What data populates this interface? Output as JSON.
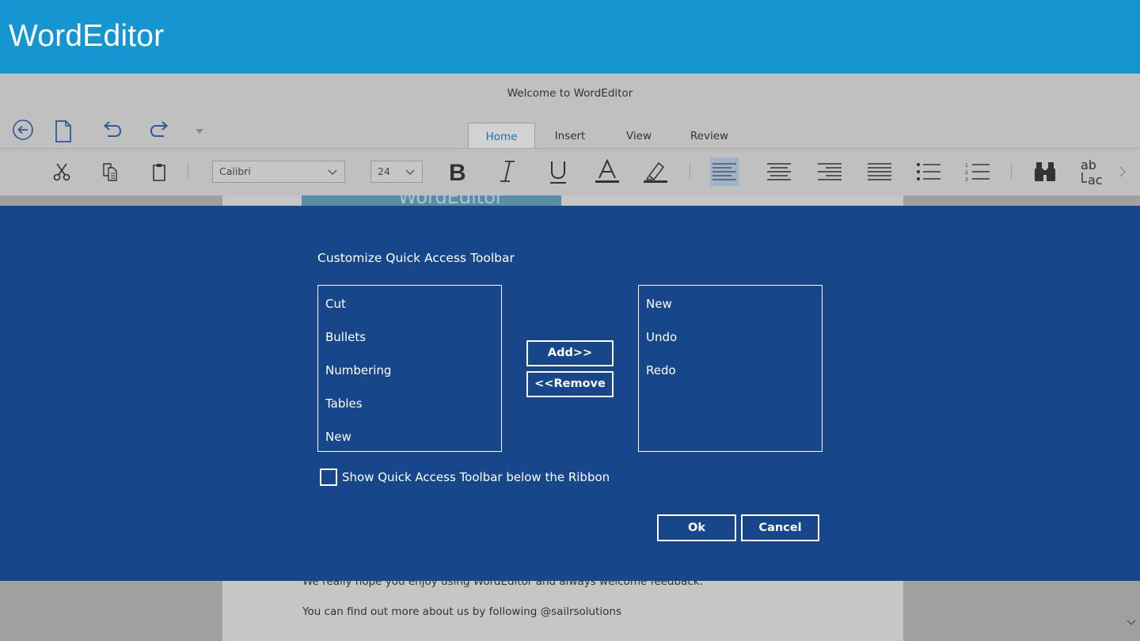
{
  "app": {
    "title": "WordEditor"
  },
  "document": {
    "title": "Welcome to WordEditor"
  },
  "quick_access": {
    "icons": [
      "back-arrow-icon",
      "new-document-icon",
      "undo-icon",
      "redo-icon",
      "dropdown-icon"
    ]
  },
  "tabs": [
    {
      "label": "Home",
      "active": true
    },
    {
      "label": "Insert",
      "active": false
    },
    {
      "label": "View",
      "active": false
    },
    {
      "label": "Review",
      "active": false
    }
  ],
  "toolbar": {
    "font_name": "Calibri",
    "font_size": "24",
    "find_replace_text": "ab\n↳ac"
  },
  "document_body": {
    "logo_text": "WordEditor",
    "line1": "We really hope you enjoy using WordEditor and always welcome feedback.",
    "line2": "You can find out more about us by following @sailrsolutions"
  },
  "dialog": {
    "title": "Customize Quick Access Toolbar",
    "available_commands": [
      "Cut",
      "Bullets",
      "Numbering",
      "Tables",
      "New"
    ],
    "toolbar_commands": [
      "New",
      "Undo",
      "Redo"
    ],
    "add_label": "Add>>",
    "remove_label": "<<Remove",
    "show_below_label": "Show Quick Access Toolbar below the Ribbon",
    "show_below_checked": false,
    "ok_label": "Ok",
    "cancel_label": "Cancel"
  },
  "colors": {
    "title_bar": "#1596d1",
    "dialog_background": "#17478a",
    "ribbon_background": "#c0c0c0",
    "active_tab_text": "#1f6eb4"
  }
}
